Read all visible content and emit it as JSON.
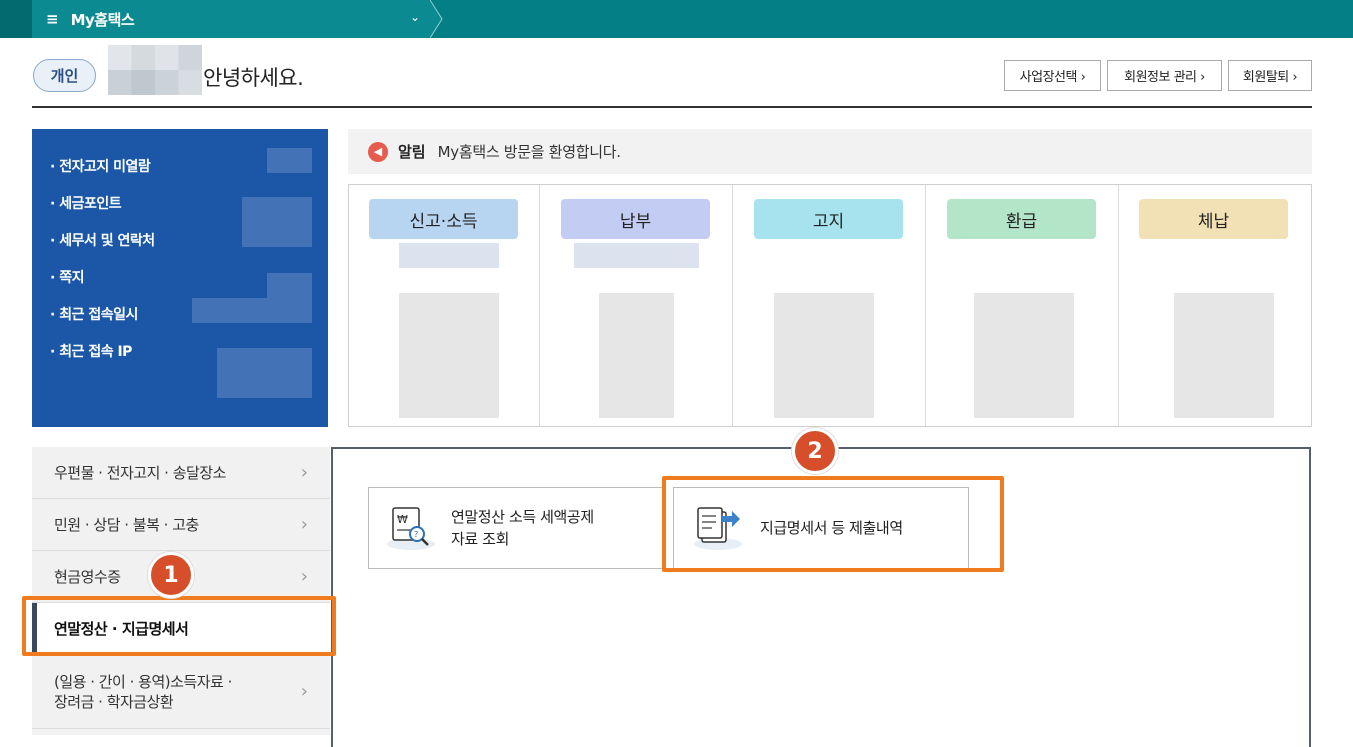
{
  "topbar": {
    "menu_icon": "≡",
    "title": "My홈택스",
    "chevron": "⌄"
  },
  "header": {
    "badge": "개인",
    "greeting": "안녕하세요.",
    "buttons": [
      "사업장선택 ›",
      "회원정보 관리 ›",
      "회원탈퇴 ›"
    ]
  },
  "info": {
    "items": [
      "· 전자고지 미열람",
      "· 세금포인트",
      "· 세무서 및 연락처",
      "· 쪽지",
      "· 최근 접속일시",
      "· 최근 접속 IP"
    ]
  },
  "notice": {
    "label": "알림",
    "text": "My홈택스 방문을 환영합니다."
  },
  "status": {
    "tabs": [
      {
        "label": "신고·소득",
        "color": "#b7d4f0"
      },
      {
        "label": "납부",
        "color": "#c3cdf3"
      },
      {
        "label": "고지",
        "color": "#a6e3ee"
      },
      {
        "label": "환급",
        "color": "#b3e5c8"
      },
      {
        "label": "체납",
        "color": "#f1e1b4"
      }
    ]
  },
  "leftmenu": {
    "items": [
      {
        "label": "우편물 · 전자고지 · 송달장소",
        "chevron": "›"
      },
      {
        "label": "민원 · 상담 · 불복 · 고충",
        "chevron": "›"
      },
      {
        "label": "현금영수증",
        "chevron": "›"
      },
      {
        "label": "연말정산 · 지급명세서",
        "chevron": ""
      },
      {
        "label1": "(일용 · 간이 · 용역)소득자료 ·",
        "label2": "장려금 · 학자금상환",
        "chevron": "›"
      }
    ]
  },
  "content": {
    "cards": [
      {
        "line1": "연말정산 소득 세액공제",
        "line2": "자료 조회"
      },
      {
        "line1": "지급명세서 등 제출내역"
      }
    ]
  },
  "steps": {
    "one": "1",
    "two": "2"
  },
  "colors": {
    "topbar": "#047f86",
    "highlight": "#f07c1f",
    "step": "#d64f2a",
    "info_bg": "#1b57a6"
  }
}
